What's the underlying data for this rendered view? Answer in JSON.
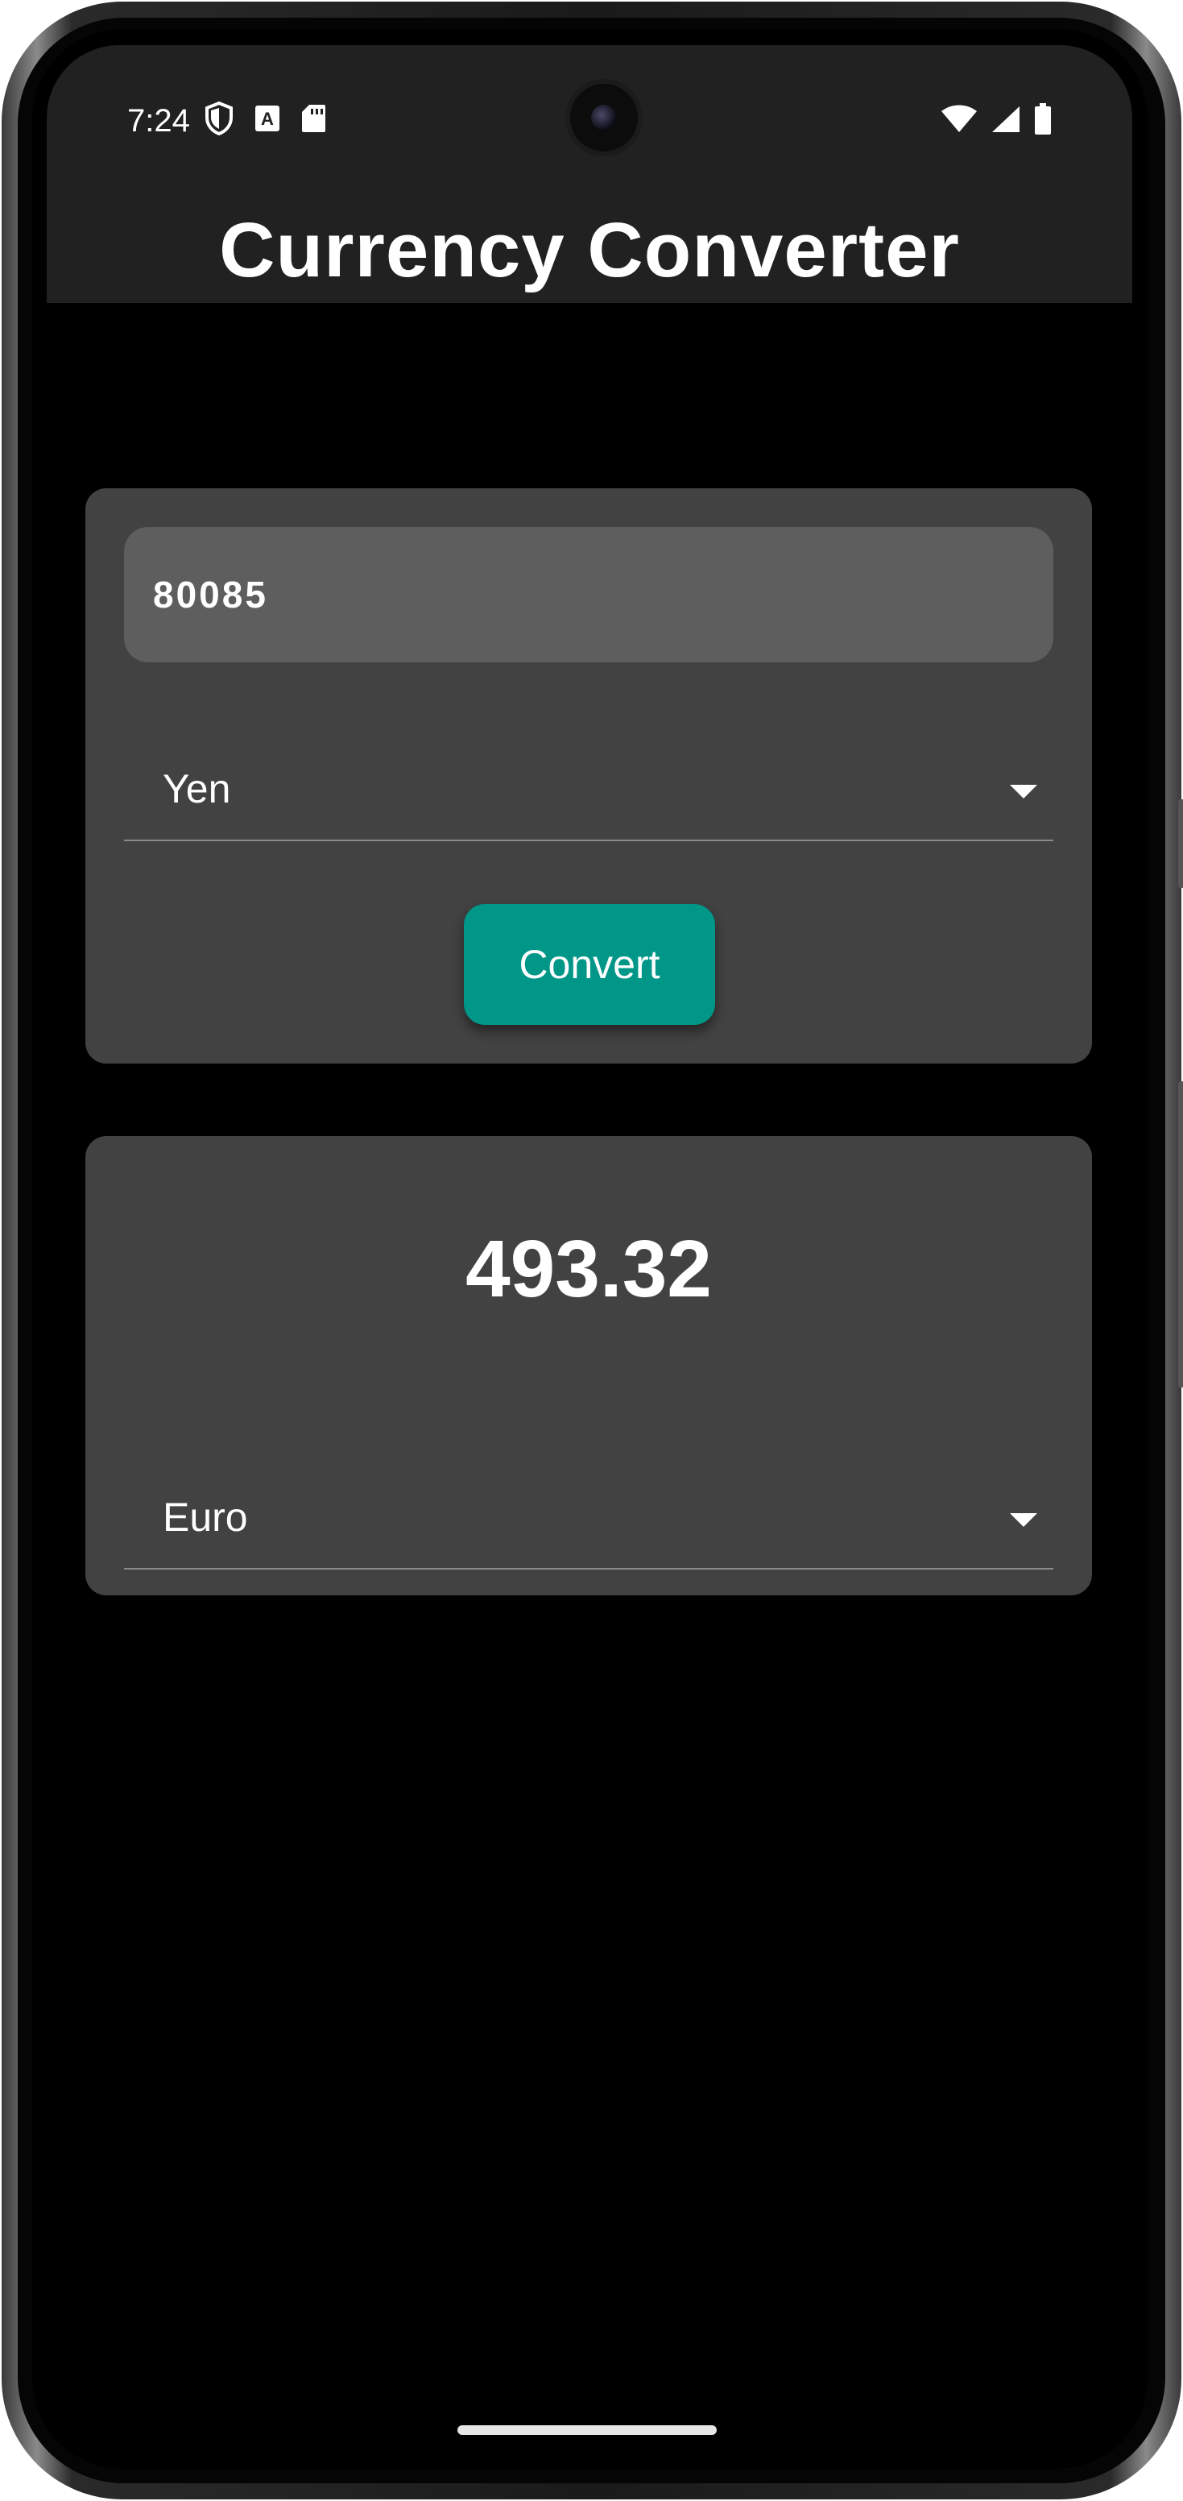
{
  "status_bar": {
    "time": "7:24",
    "left_icons": [
      "shield-icon",
      "font-a-icon",
      "sd-card-icon"
    ],
    "right_icons": [
      "wifi-icon",
      "cell-signal-icon",
      "battery-icon"
    ]
  },
  "app_bar": {
    "title": "Currency Converter"
  },
  "input_card": {
    "amount_value": "80085",
    "from_currency": "Yen",
    "convert_label": "Convert"
  },
  "output_card": {
    "result_value": "493.32",
    "to_currency": "Euro"
  },
  "colors": {
    "accent": "#009688",
    "card_background": "#424242",
    "app_bar": "#212121",
    "screen_background": "#000000"
  }
}
